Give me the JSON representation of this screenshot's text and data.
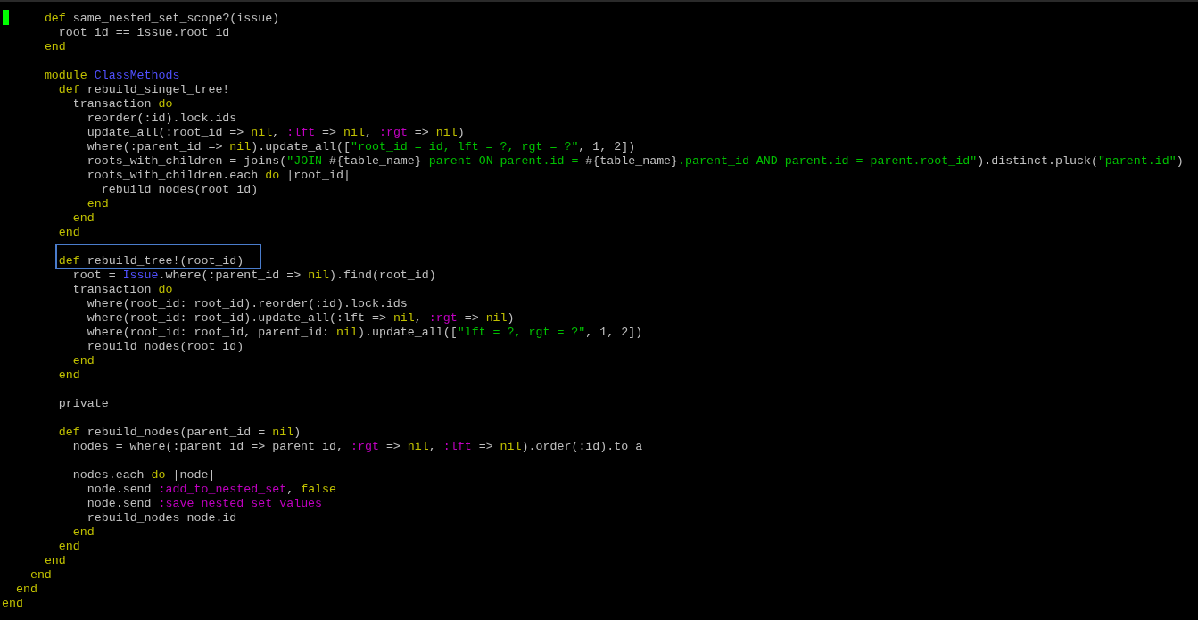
{
  "terminal": {
    "blocks": [
      {
        "lines": [
          {
            "cursor": true,
            "boxed": false,
            "segments": [
              {
                "kind": "keyword",
                "text": "      def"
              },
              {
                "kind": "plain",
                "text": " same_nested_set_scope?(issue)"
              }
            ]
          },
          {
            "cursor": false,
            "boxed": false,
            "segments": [
              {
                "kind": "plain",
                "text": "        root_id == issue.root_id"
              }
            ]
          },
          {
            "cursor": false,
            "boxed": false,
            "segments": [
              {
                "kind": "keyword",
                "text": "      end"
              }
            ]
          }
        ]
      },
      {
        "lines": [
          {
            "cursor": false,
            "boxed": false,
            "segments": [
              {
                "kind": "keyword",
                "text": "      module "
              },
              {
                "kind": "constant",
                "text": "ClassMethods"
              }
            ]
          },
          {
            "cursor": false,
            "boxed": false,
            "segments": [
              {
                "kind": "keyword",
                "text": "        def"
              },
              {
                "kind": "plain",
                "text": " rebuild_singel_tree!"
              }
            ]
          },
          {
            "cursor": false,
            "boxed": false,
            "segments": [
              {
                "kind": "plain",
                "text": "          transaction "
              },
              {
                "kind": "keyword",
                "text": "do"
              }
            ]
          },
          {
            "cursor": false,
            "boxed": false,
            "segments": [
              {
                "kind": "plain",
                "text": "            reorder(:id).lock.ids"
              }
            ]
          },
          {
            "cursor": false,
            "boxed": false,
            "segments": [
              {
                "kind": "plain",
                "text": "            update_all(:root_id => "
              },
              {
                "kind": "keyword",
                "text": "nil"
              },
              {
                "kind": "plain",
                "text": ", "
              },
              {
                "kind": "symbol",
                "text": ":lft"
              },
              {
                "kind": "plain",
                "text": " => "
              },
              {
                "kind": "keyword",
                "text": "nil"
              },
              {
                "kind": "plain",
                "text": ", "
              },
              {
                "kind": "symbol",
                "text": ":rgt"
              },
              {
                "kind": "plain",
                "text": " => "
              },
              {
                "kind": "keyword",
                "text": "nil"
              },
              {
                "kind": "plain",
                "text": ")"
              }
            ]
          },
          {
            "cursor": false,
            "boxed": false,
            "segments": [
              {
                "kind": "plain",
                "text": "            where(:parent_id => "
              },
              {
                "kind": "keyword",
                "text": "nil"
              },
              {
                "kind": "plain",
                "text": ").update_all(["
              },
              {
                "kind": "string",
                "text": "\"root_id = id, lft = ?, rgt = ?\""
              },
              {
                "kind": "plain",
                "text": ", 1, 2])"
              }
            ]
          },
          {
            "cursor": false,
            "boxed": false,
            "segments": [
              {
                "kind": "plain",
                "text": "            roots_with_children = joins("
              },
              {
                "kind": "string",
                "text": "\"JOIN "
              },
              {
                "kind": "interp",
                "text": "#{table_name}"
              },
              {
                "kind": "string",
                "text": " parent ON parent.id = "
              },
              {
                "kind": "interp",
                "text": "#{table_name}"
              },
              {
                "kind": "string",
                "text": ".parent_id AND parent.id = parent.root_id\""
              },
              {
                "kind": "plain",
                "text": ").distinct.pluck("
              },
              {
                "kind": "string",
                "text": "\"parent.id\""
              },
              {
                "kind": "plain",
                "text": ")"
              }
            ]
          },
          {
            "cursor": false,
            "boxed": false,
            "segments": [
              {
                "kind": "plain",
                "text": "            roots_with_children.each "
              },
              {
                "kind": "keyword",
                "text": "do"
              },
              {
                "kind": "plain",
                "text": " |root_id|"
              }
            ]
          },
          {
            "cursor": false,
            "boxed": false,
            "segments": [
              {
                "kind": "plain",
                "text": "              rebuild_nodes(root_id)"
              }
            ]
          },
          {
            "cursor": false,
            "boxed": false,
            "segments": [
              {
                "kind": "keyword",
                "text": "            end"
              }
            ]
          },
          {
            "cursor": false,
            "boxed": false,
            "segments": [
              {
                "kind": "keyword",
                "text": "          end"
              }
            ]
          },
          {
            "cursor": false,
            "boxed": false,
            "segments": [
              {
                "kind": "keyword",
                "text": "        end"
              }
            ]
          }
        ]
      },
      {
        "lines": [
          {
            "cursor": false,
            "boxed": true,
            "segments": [
              {
                "kind": "keyword",
                "text": "        def"
              },
              {
                "kind": "plain",
                "text": " rebuild_tree!(root_id)"
              }
            ]
          },
          {
            "cursor": false,
            "boxed": false,
            "segments": [
              {
                "kind": "plain",
                "text": "          root = "
              },
              {
                "kind": "constant",
                "text": "Issue"
              },
              {
                "kind": "plain",
                "text": ".where(:parent_id => "
              },
              {
                "kind": "keyword",
                "text": "nil"
              },
              {
                "kind": "plain",
                "text": ").find(root_id)"
              }
            ]
          },
          {
            "cursor": false,
            "boxed": false,
            "segments": [
              {
                "kind": "plain",
                "text": "          transaction "
              },
              {
                "kind": "keyword",
                "text": "do"
              }
            ]
          },
          {
            "cursor": false,
            "boxed": false,
            "segments": [
              {
                "kind": "plain",
                "text": "            where(root_id: root_id).reorder(:id).lock.ids"
              }
            ]
          },
          {
            "cursor": false,
            "boxed": false,
            "segments": [
              {
                "kind": "plain",
                "text": "            where(root_id: root_id).update_all(:lft => "
              },
              {
                "kind": "keyword",
                "text": "nil"
              },
              {
                "kind": "plain",
                "text": ", "
              },
              {
                "kind": "symbol",
                "text": ":rgt"
              },
              {
                "kind": "plain",
                "text": " => "
              },
              {
                "kind": "keyword",
                "text": "nil"
              },
              {
                "kind": "plain",
                "text": ")"
              }
            ]
          },
          {
            "cursor": false,
            "boxed": false,
            "segments": [
              {
                "kind": "plain",
                "text": "            where(root_id: root_id, parent_id: "
              },
              {
                "kind": "keyword",
                "text": "nil"
              },
              {
                "kind": "plain",
                "text": ").update_all(["
              },
              {
                "kind": "string",
                "text": "\"lft = ?, rgt = ?\""
              },
              {
                "kind": "plain",
                "text": ", 1, 2])"
              }
            ]
          },
          {
            "cursor": false,
            "boxed": false,
            "segments": [
              {
                "kind": "plain",
                "text": "            rebuild_nodes(root_id)"
              }
            ]
          },
          {
            "cursor": false,
            "boxed": false,
            "segments": [
              {
                "kind": "keyword",
                "text": "          end"
              }
            ]
          },
          {
            "cursor": false,
            "boxed": false,
            "segments": [
              {
                "kind": "keyword",
                "text": "        end"
              }
            ]
          }
        ]
      },
      {
        "lines": [
          {
            "cursor": false,
            "boxed": false,
            "segments": [
              {
                "kind": "plain",
                "text": "        private"
              }
            ]
          }
        ]
      },
      {
        "lines": [
          {
            "cursor": false,
            "boxed": false,
            "segments": [
              {
                "kind": "keyword",
                "text": "        def"
              },
              {
                "kind": "plain",
                "text": " rebuild_nodes(parent_id = "
              },
              {
                "kind": "keyword",
                "text": "nil"
              },
              {
                "kind": "plain",
                "text": ")"
              }
            ]
          },
          {
            "cursor": false,
            "boxed": false,
            "segments": [
              {
                "kind": "plain",
                "text": "          nodes = where(:parent_id => parent_id, "
              },
              {
                "kind": "symbol",
                "text": ":rgt"
              },
              {
                "kind": "plain",
                "text": " => "
              },
              {
                "kind": "keyword",
                "text": "nil"
              },
              {
                "kind": "plain",
                "text": ", "
              },
              {
                "kind": "symbol",
                "text": ":lft"
              },
              {
                "kind": "plain",
                "text": " => "
              },
              {
                "kind": "keyword",
                "text": "nil"
              },
              {
                "kind": "plain",
                "text": ").order(:id).to_a"
              }
            ]
          }
        ]
      },
      {
        "lines": [
          {
            "cursor": false,
            "boxed": false,
            "segments": [
              {
                "kind": "plain",
                "text": "          nodes.each "
              },
              {
                "kind": "keyword",
                "text": "do"
              },
              {
                "kind": "plain",
                "text": " |node|"
              }
            ]
          },
          {
            "cursor": false,
            "boxed": false,
            "segments": [
              {
                "kind": "plain",
                "text": "            node.send "
              },
              {
                "kind": "symbol",
                "text": ":add_to_nested_set"
              },
              {
                "kind": "plain",
                "text": ", "
              },
              {
                "kind": "keyword",
                "text": "false"
              }
            ]
          },
          {
            "cursor": false,
            "boxed": false,
            "segments": [
              {
                "kind": "plain",
                "text": "            node.send "
              },
              {
                "kind": "symbol",
                "text": ":save_nested_set_values"
              }
            ]
          },
          {
            "cursor": false,
            "boxed": false,
            "segments": [
              {
                "kind": "plain",
                "text": "            rebuild_nodes node.id"
              }
            ]
          },
          {
            "cursor": false,
            "boxed": false,
            "segments": [
              {
                "kind": "keyword",
                "text": "          end"
              }
            ]
          },
          {
            "cursor": false,
            "boxed": false,
            "segments": [
              {
                "kind": "keyword",
                "text": "        end"
              }
            ]
          },
          {
            "cursor": false,
            "boxed": false,
            "segments": [
              {
                "kind": "keyword",
                "text": "      end"
              }
            ]
          },
          {
            "cursor": false,
            "boxed": false,
            "segments": [
              {
                "kind": "keyword",
                "text": "    end"
              }
            ]
          },
          {
            "cursor": false,
            "boxed": false,
            "segments": [
              {
                "kind": "keyword",
                "text": "  end"
              }
            ]
          },
          {
            "cursor": false,
            "boxed": false,
            "segments": [
              {
                "kind": "keyword",
                "text": "end"
              }
            ]
          }
        ]
      }
    ]
  }
}
